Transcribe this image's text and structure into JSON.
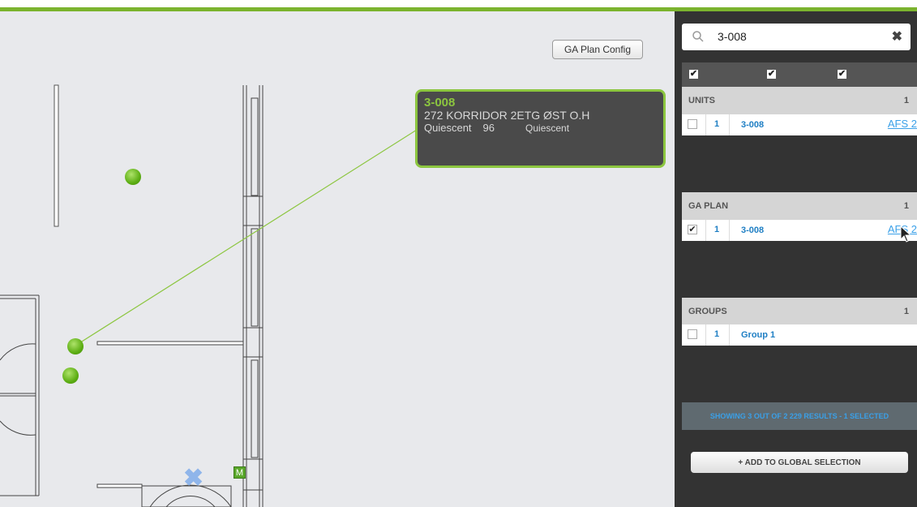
{
  "map": {
    "gaplan_button": "GA Plan Config",
    "tooltip": {
      "title": "3-008",
      "line1": "272 KORRIDOR 2ETG ØST O.H",
      "status": "Quiescent",
      "value": "96",
      "status2": "Quiescent"
    },
    "m_badge": "M"
  },
  "panel": {
    "search": {
      "value": "3-008",
      "clear_icon": "close-icon"
    },
    "units": {
      "label": "UNITS",
      "count": "1",
      "rows": [
        {
          "checked": false,
          "num": "1",
          "name": "3-008",
          "link": "AFS 2"
        }
      ]
    },
    "gaplan": {
      "label": "GA PLAN",
      "count": "1",
      "rows": [
        {
          "checked": true,
          "num": "1",
          "name": "3-008",
          "link": "AFS 2"
        }
      ]
    },
    "groups": {
      "label": "GROUPS",
      "count": "1",
      "rows": [
        {
          "checked": false,
          "num": "1",
          "name": "Group 1",
          "link": ""
        }
      ]
    },
    "status": "SHOWING 3 OUT OF 2 229 RESULTS - 1 SELECTED",
    "add_button": "+ ADD TO GLOBAL SELECTION"
  },
  "colors": {
    "accent": "#8cc63f",
    "link": "#1f7fc4",
    "panel": "#333333"
  }
}
